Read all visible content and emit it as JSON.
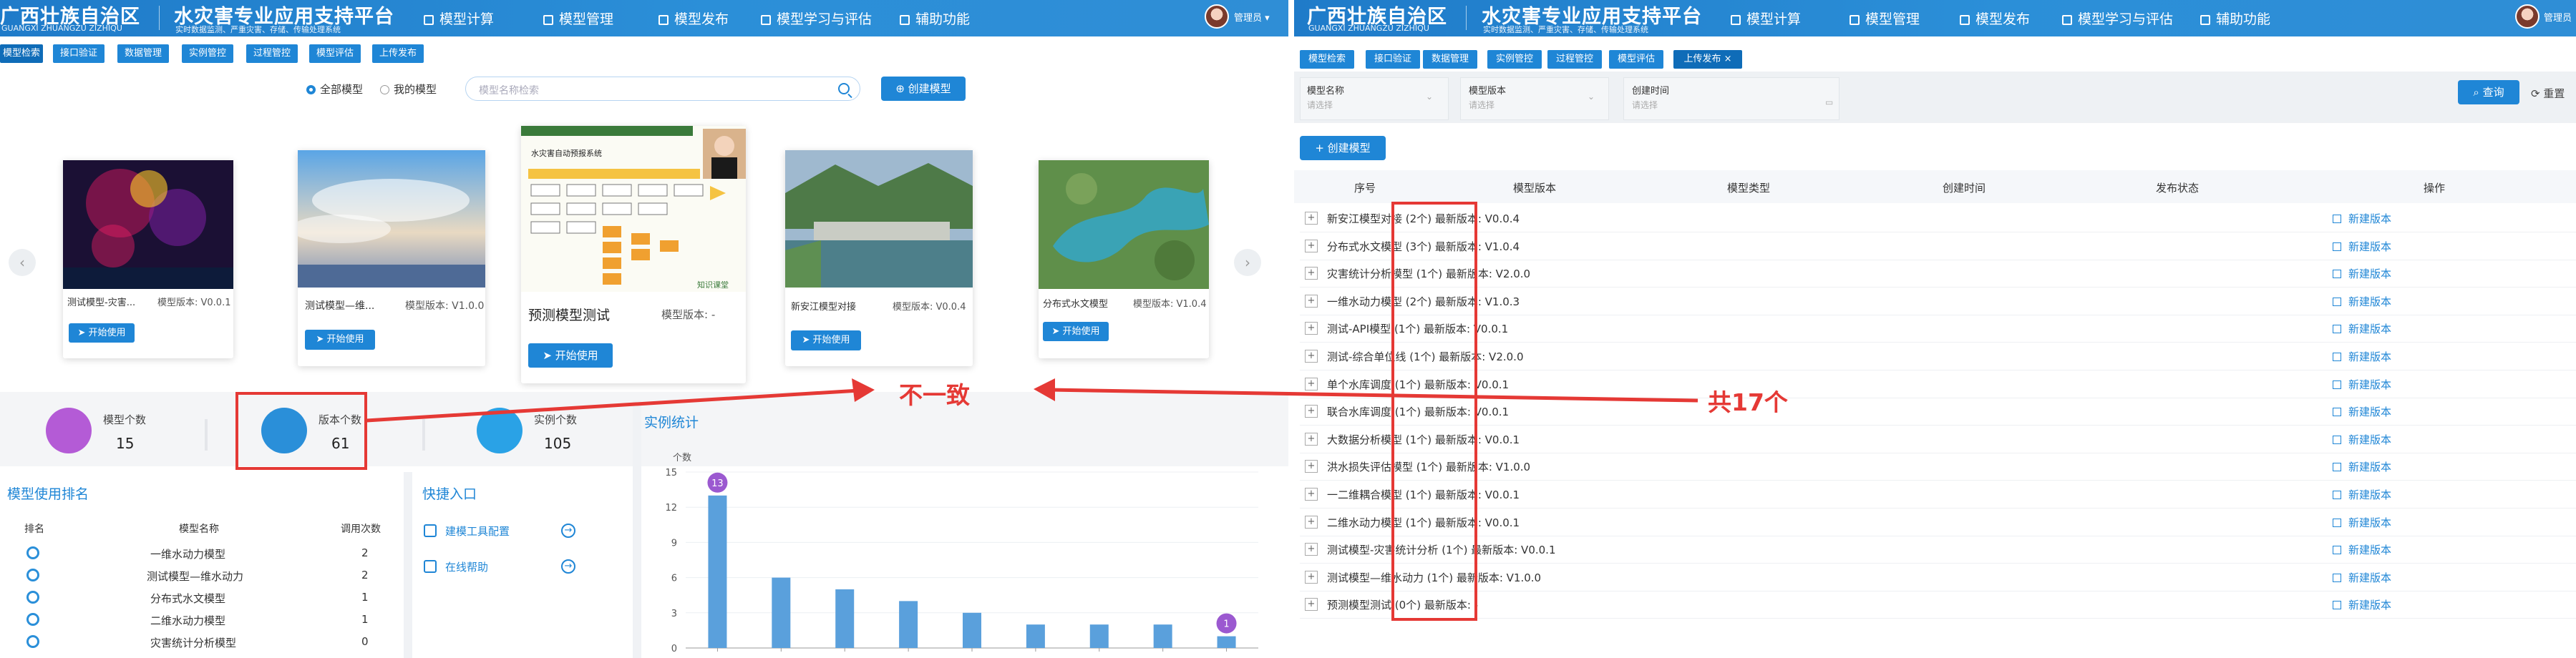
{
  "app": {
    "title": "广西壮族自治区",
    "title_pinyin": "GUANGXI ZHUANGZU ZIZHIQU",
    "platform_title": "水灾害专业应用支持平台",
    "platform_sub": "实时数据监测、严重灾害、存储、传输处理系统",
    "nav": [
      "模型计算",
      "模型管理",
      "模型发布",
      "模型学习与评估",
      "辅助功能"
    ],
    "user_name": "管理员"
  },
  "left": {
    "tabs": [
      "模型检索",
      "接口验证",
      "数据管理",
      "实例管控",
      "过程管控",
      "模型评估",
      "上传发布"
    ],
    "radio_all": "全部模型",
    "radio_mine": "我的模型",
    "search_placeholder": "模型名称检索",
    "create_button": "创建模型",
    "cards": [
      {
        "name": "测试模型-灾害...",
        "version": "模型版本: V0.0.1",
        "use": "开始使用",
        "img": "fireworks"
      },
      {
        "name": "测试模型—维...",
        "version": "模型版本: V1.0.0",
        "use": "开始使用",
        "img": "sky"
      },
      {
        "name": "预测模型测试",
        "version": "模型版本: -",
        "use": "开始使用",
        "img": "diagram"
      },
      {
        "name": "新安江模型对接",
        "version": "模型版本: V0.0.4",
        "use": "开始使用",
        "img": "dam"
      },
      {
        "name": "分布式水文模型",
        "version": "模型版本: V1.0.4",
        "use": "开始使用",
        "img": "reservoir"
      }
    ],
    "diagram_title": "水灾害自动预报系统",
    "diagram_foot": "知识课堂",
    "stats": [
      {
        "label": "模型个数",
        "value": "15",
        "color": "#b45bd6"
      },
      {
        "label": "版本个数",
        "value": "61",
        "color": "#2a8fd9"
      },
      {
        "label": "实例个数",
        "value": "105",
        "color": "#2aa2e6"
      }
    ],
    "ranking": {
      "title": "模型使用排名",
      "headers": [
        "排名",
        "模型名称",
        "调用次数"
      ],
      "rows": [
        {
          "name": "一维水动力模型",
          "count": "2"
        },
        {
          "name": "测试模型—维水动力",
          "count": "2"
        },
        {
          "name": "分布式水文模型",
          "count": "1"
        },
        {
          "name": "二维水动力模型",
          "count": "1"
        },
        {
          "name": "灾害统计分析模型",
          "count": "0"
        }
      ]
    },
    "quick": {
      "title": "快捷入口",
      "items": [
        "建模工具配置",
        "在线帮助"
      ]
    },
    "chart_title": "实例统计",
    "chart_data": {
      "type": "bar",
      "title": "实例统计",
      "ylabel": "个数",
      "ylim": [
        0,
        15
      ],
      "yticks": [
        "0",
        "3",
        "6",
        "9",
        "12",
        "15"
      ],
      "categories": [
        "",
        "",
        "",
        "",
        "",
        "",
        "",
        "",
        ""
      ],
      "values": [
        13,
        6,
        5,
        4,
        3,
        2,
        2,
        2,
        1
      ],
      "highlight_labels": [
        "13",
        "1"
      ]
    }
  },
  "right": {
    "tabs": [
      "模型检索",
      "接口验证",
      "数据管理",
      "实例管控",
      "过程管控",
      "模型评估",
      "上传发布"
    ],
    "filters": [
      {
        "label": "模型名称",
        "placeholder": "请选择"
      },
      {
        "label": "模型版本",
        "placeholder": "请选择"
      },
      {
        "label": "创建时间",
        "placeholder": "请选择"
      }
    ],
    "query_button": "查询",
    "reset_button": "重置",
    "create_button": "创建模型",
    "headers": [
      "序号",
      "模型版本",
      "模型类型",
      "创建时间",
      "发布状态",
      "操作"
    ],
    "rows": [
      {
        "name": "新安江模型对接",
        "count": "(2个)",
        "latest": "最新版本: V0.0.4"
      },
      {
        "name": "分布式水文模型",
        "count": "(3个)",
        "latest": "最新版本: V1.0.4"
      },
      {
        "name": "灾害统计分析模型",
        "count": "(1个)",
        "latest": "最新版本: V2.0.0"
      },
      {
        "name": "一维水动力模型",
        "count": "(2个)",
        "latest": "最新版本: V1.0.3"
      },
      {
        "name": "测试-API模型",
        "count": "(1个)",
        "latest": "最新版本: V0.0.1"
      },
      {
        "name": "测试-综合单位线",
        "count": "(1个)",
        "latest": "最新版本: V2.0.0"
      },
      {
        "name": "单个水库调度",
        "count": "(1个)",
        "latest": "最新版本: V0.0.1"
      },
      {
        "name": "联合水库调度",
        "count": "(1个)",
        "latest": "最新版本: V0.0.1"
      },
      {
        "name": "大数据分析模型",
        "count": "(1个)",
        "latest": "最新版本: V0.0.1"
      },
      {
        "name": "洪水损失评估模型",
        "count": "(1个)",
        "latest": "最新版本: V1.0.0"
      },
      {
        "name": "一二维耦合模型",
        "count": "(1个)",
        "latest": "最新版本: V0.0.1"
      },
      {
        "name": "二维水动力模型",
        "count": "(1个)",
        "latest": "最新版本: V0.0.1"
      },
      {
        "name": "测试模型-灾害统计分析",
        "count": "(1个)",
        "latest": "最新版本: V0.0.1"
      },
      {
        "name": "测试模型—维水动力",
        "count": "(1个)",
        "latest": "最新版本: V1.0.0"
      },
      {
        "name": "预测模型测试",
        "count": "(0个)",
        "latest": "最新版本: -"
      }
    ],
    "row_action": "新建版本"
  },
  "annotations": {
    "mismatch": "不一致",
    "total": "共17个"
  }
}
